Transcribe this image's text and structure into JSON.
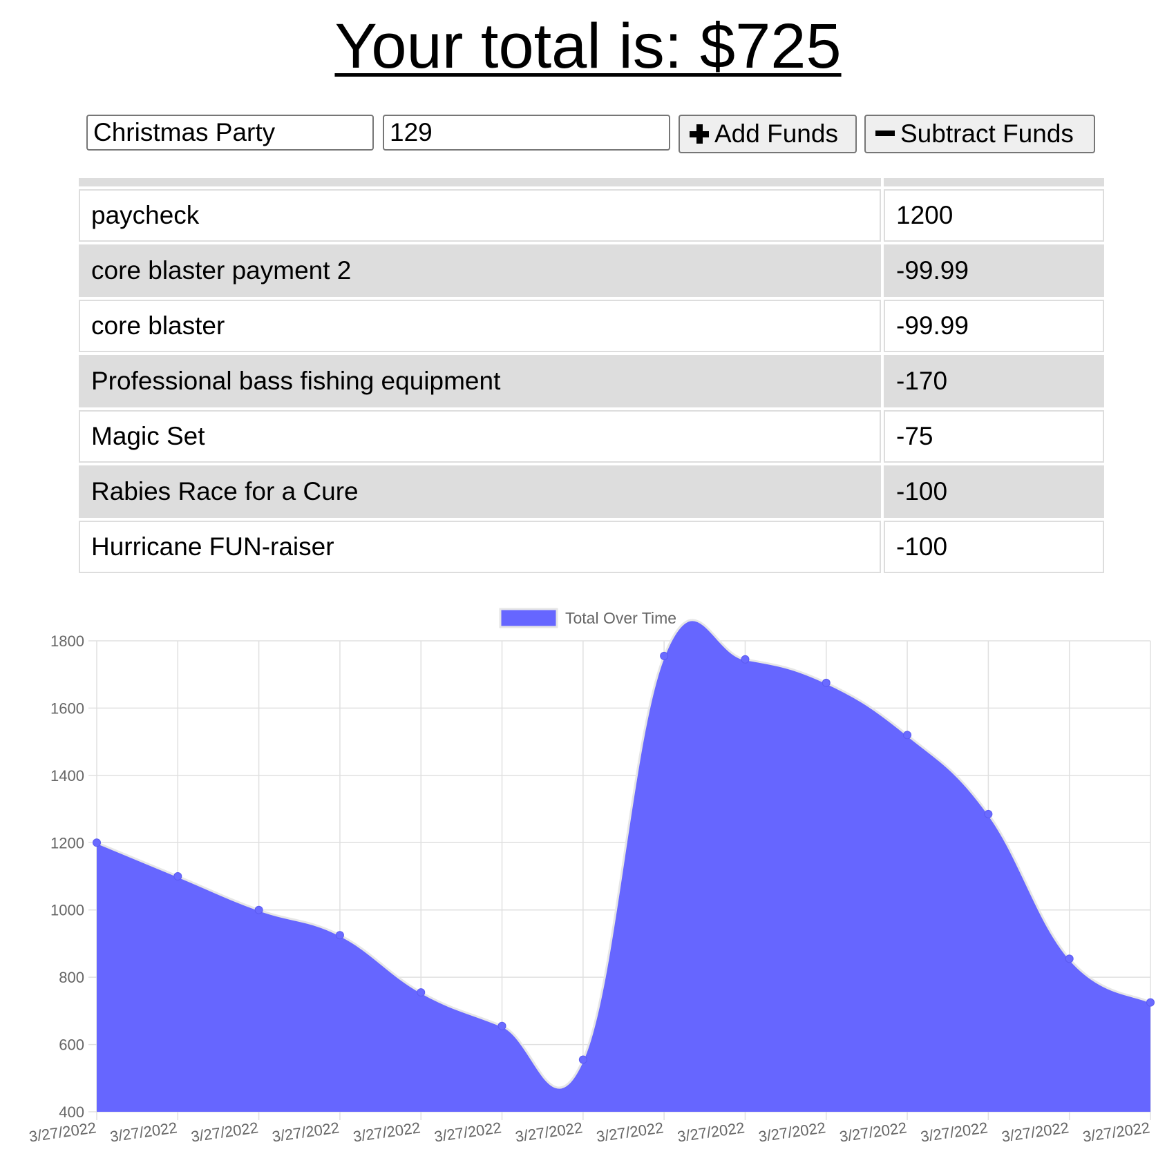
{
  "header": {
    "total_label": "Your total is: $725"
  },
  "form": {
    "name_value": "Christmas Party",
    "amount_value": "129",
    "add_label": "Add Funds",
    "subtract_label": "Subtract Funds"
  },
  "transactions": [
    {
      "name": "paycheck",
      "value": "1200"
    },
    {
      "name": "core blaster payment 2",
      "value": "-99.99"
    },
    {
      "name": "core blaster",
      "value": "-99.99"
    },
    {
      "name": "Professional bass fishing equipment",
      "value": "-170"
    },
    {
      "name": "Magic Set",
      "value": "-75"
    },
    {
      "name": "Rabies Race for a Cure",
      "value": "-100"
    },
    {
      "name": "Hurricane FUN-raiser",
      "value": "-100"
    }
  ],
  "chart_data": {
    "type": "area",
    "legend": "Total Over Time",
    "legend_position": "top",
    "x": [
      "3/27/2022",
      "3/27/2022",
      "3/27/2022",
      "3/27/2022",
      "3/27/2022",
      "3/27/2022",
      "3/27/2022",
      "3/27/2022",
      "3/27/2022",
      "3/27/2022",
      "3/27/2022",
      "3/27/2022",
      "3/27/2022",
      "3/27/2022"
    ],
    "series": [
      {
        "name": "Total Over Time",
        "values": [
          1200,
          1100,
          1000,
          925,
          755,
          655,
          555,
          1755,
          1745,
          1675,
          1520,
          1285,
          855,
          725
        ]
      }
    ],
    "ylim": [
      400,
      1800
    ],
    "yticks": [
      400,
      600,
      800,
      1000,
      1200,
      1400,
      1600,
      1800
    ],
    "grid": true,
    "fill_color": "#6666ff",
    "line_color": "#e6e6e6",
    "point_color": "#6a6aff"
  }
}
